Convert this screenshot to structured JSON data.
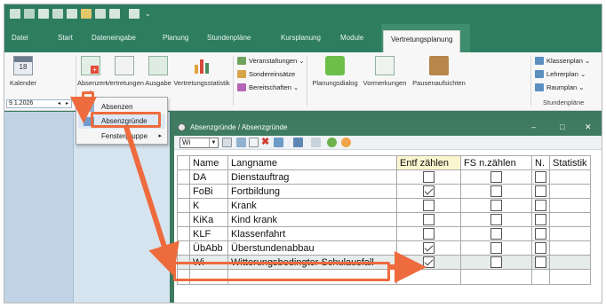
{
  "ribbon_tabs": [
    "Datei",
    "Start",
    "Dateneingabe",
    "Planung",
    "Stundenpläne",
    "Kursplanung",
    "Module",
    "Vertretungsplanung"
  ],
  "active_tab": "Vertretungsplanung",
  "ribbon": {
    "kalender": "Kalender",
    "absenzen": "Absenzen",
    "vertretungen": "Vertretungen",
    "ausgabe": "Ausgabe",
    "vertretungsstatistik": "Vertretungsstatistik",
    "veranstaltungen": "Veranstaltungen ⌄",
    "sondereinsaetze": "Sondereinsätze",
    "bereitschaften": "Bereitschaften ⌄",
    "planungsdialog": "Planungsdialog",
    "vormerkungen": "Vormerkungen",
    "pausenaufsichten": "Pausenaufsichten",
    "klassenplan": "Klassenplan ⌄",
    "lehrerplan": "Lehrerplan ⌄",
    "raumplan": "Raumplan ⌄",
    "stundenplaene_group": "Stundenpläne",
    "date": "9.1.2026"
  },
  "menu": {
    "items": [
      "Absenzen",
      "Absenzgründe",
      "Fenstergruppe"
    ]
  },
  "subwindow": {
    "title": "Absenzgründe / Absenzgründe",
    "combo_value": "Wi",
    "minimize": "–",
    "maximize": "□",
    "close": "✕"
  },
  "grid": {
    "headers": [
      "Name",
      "Langname",
      "Entf zählen",
      "FS n.zählen",
      "N.",
      "Statistik"
    ],
    "rows": [
      {
        "name": "DA",
        "langname": "Dienstauftrag",
        "entf": false,
        "fs": false,
        "n": false
      },
      {
        "name": "FoBi",
        "langname": "Fortbildung",
        "entf": true,
        "fs": false,
        "n": false
      },
      {
        "name": "K",
        "langname": "Krank",
        "entf": false,
        "fs": false,
        "n": false
      },
      {
        "name": "KiKa",
        "langname": "Kind krank",
        "entf": false,
        "fs": false,
        "n": false
      },
      {
        "name": "KLF",
        "langname": "Klassenfahrt",
        "entf": false,
        "fs": false,
        "n": false
      },
      {
        "name": "ÜbAbb",
        "langname": "Überstundenabbau",
        "entf": true,
        "fs": false,
        "n": false
      },
      {
        "name": "Wi",
        "langname": "Witterungsbedingter Schulausfall",
        "entf": true,
        "fs": false,
        "n": false
      }
    ],
    "selected_row": "Wi"
  },
  "colors": {
    "ribbon_green": "#2e7d61",
    "annotation_orange": "#ed6b3d"
  }
}
